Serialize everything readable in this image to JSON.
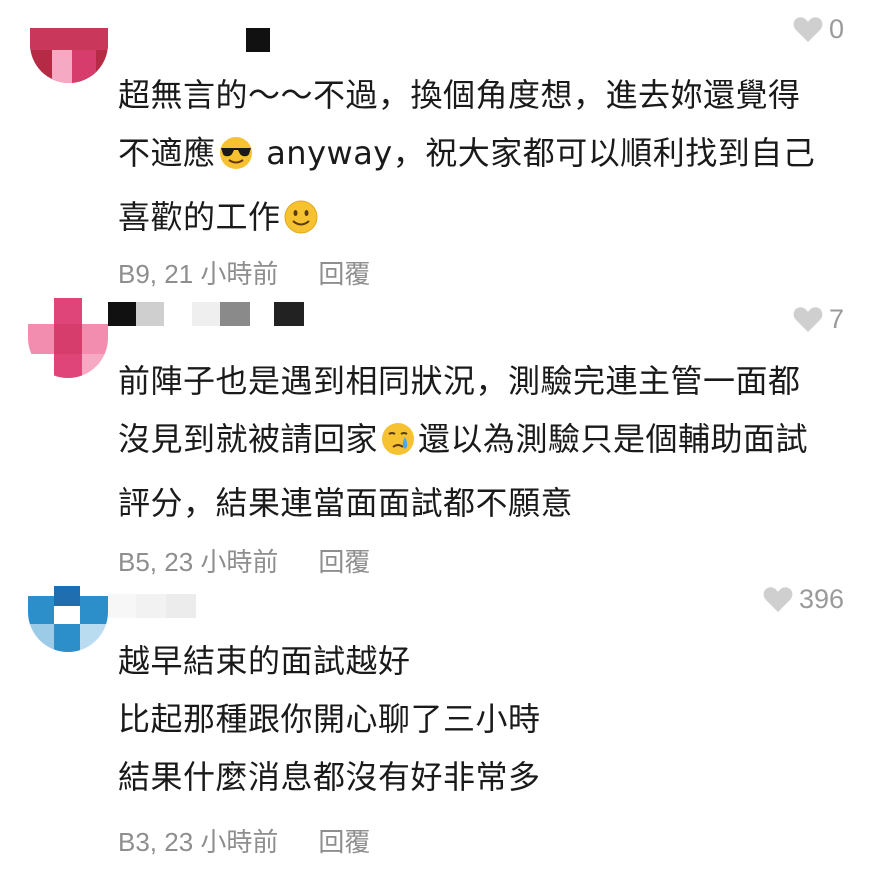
{
  "comments": [
    {
      "likes": "0",
      "lines": [
        {
          "pre": "超無言的～～不過，換個角度想，進去妳還覺得"
        },
        {
          "pre": "不適應",
          "emoji": "sunglasses-face",
          "post": " anyway，祝大家都可以順利找到自己"
        },
        {
          "pre": "喜歡的工作",
          "emoji": "slightly-smiling-face",
          "post": ""
        }
      ],
      "floor_time": "B9, 21 小時前",
      "reply_label": "回覆",
      "avatar_color": "#d63c6c"
    },
    {
      "likes": "7",
      "lines": [
        {
          "pre": "前陣子也是遇到相同狀況，測驗完連主管一面都"
        },
        {
          "pre": "沒見到就被請回家",
          "emoji": "crying-face",
          "post": "還以為測驗只是個輔助面試"
        },
        {
          "pre": "評分，結果連當面面試都不願意"
        }
      ],
      "floor_time": "B5, 23 小時前",
      "reply_label": "回覆",
      "avatar_color": "#e0457a"
    },
    {
      "likes": "396",
      "lines": [
        {
          "pre": "越早結束的面試越好"
        },
        {
          "pre": "比起那種跟你開心聊了三小時"
        },
        {
          "pre": "結果什麼消息都沒有好非常多"
        }
      ],
      "floor_time": "B3, 23 小時前",
      "reply_label": "回覆",
      "avatar_color": "#2c8fc9"
    }
  ],
  "colors": {
    "text": "#1a1a1a",
    "meta": "#8e8e8e",
    "heart": "#cfcfcf"
  }
}
